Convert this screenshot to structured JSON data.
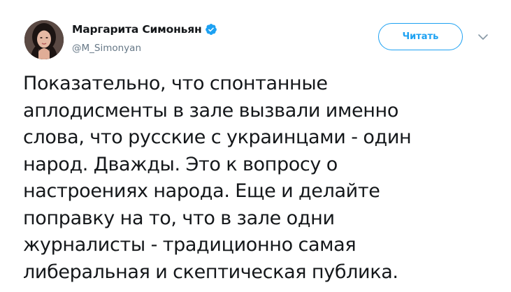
{
  "author": {
    "display_name": "Маргарита Симоньян",
    "handle": "@M_Simonyan",
    "verified": true,
    "verified_icon": "verified-badge-icon"
  },
  "follow_button": {
    "label": "Читать"
  },
  "menu": {
    "icon": "chevron-down-icon"
  },
  "tweet": {
    "lines": [
      "Показательно, что спонтанные",
      "аплодисменты в зале вызвали именно",
      "слова, что русские с украинцами - один",
      "народ. Дважды. Это к вопросу о",
      "настроениях народа. Еще и делайте",
      "поправку на то, что в зале одни",
      "журналисты - традиционно самая",
      "либеральная и скептическая публика."
    ]
  },
  "colors": {
    "accent": "#1da1f2",
    "text": "#14171a",
    "secondary_text": "#657786",
    "chevron": "#8899a6"
  }
}
